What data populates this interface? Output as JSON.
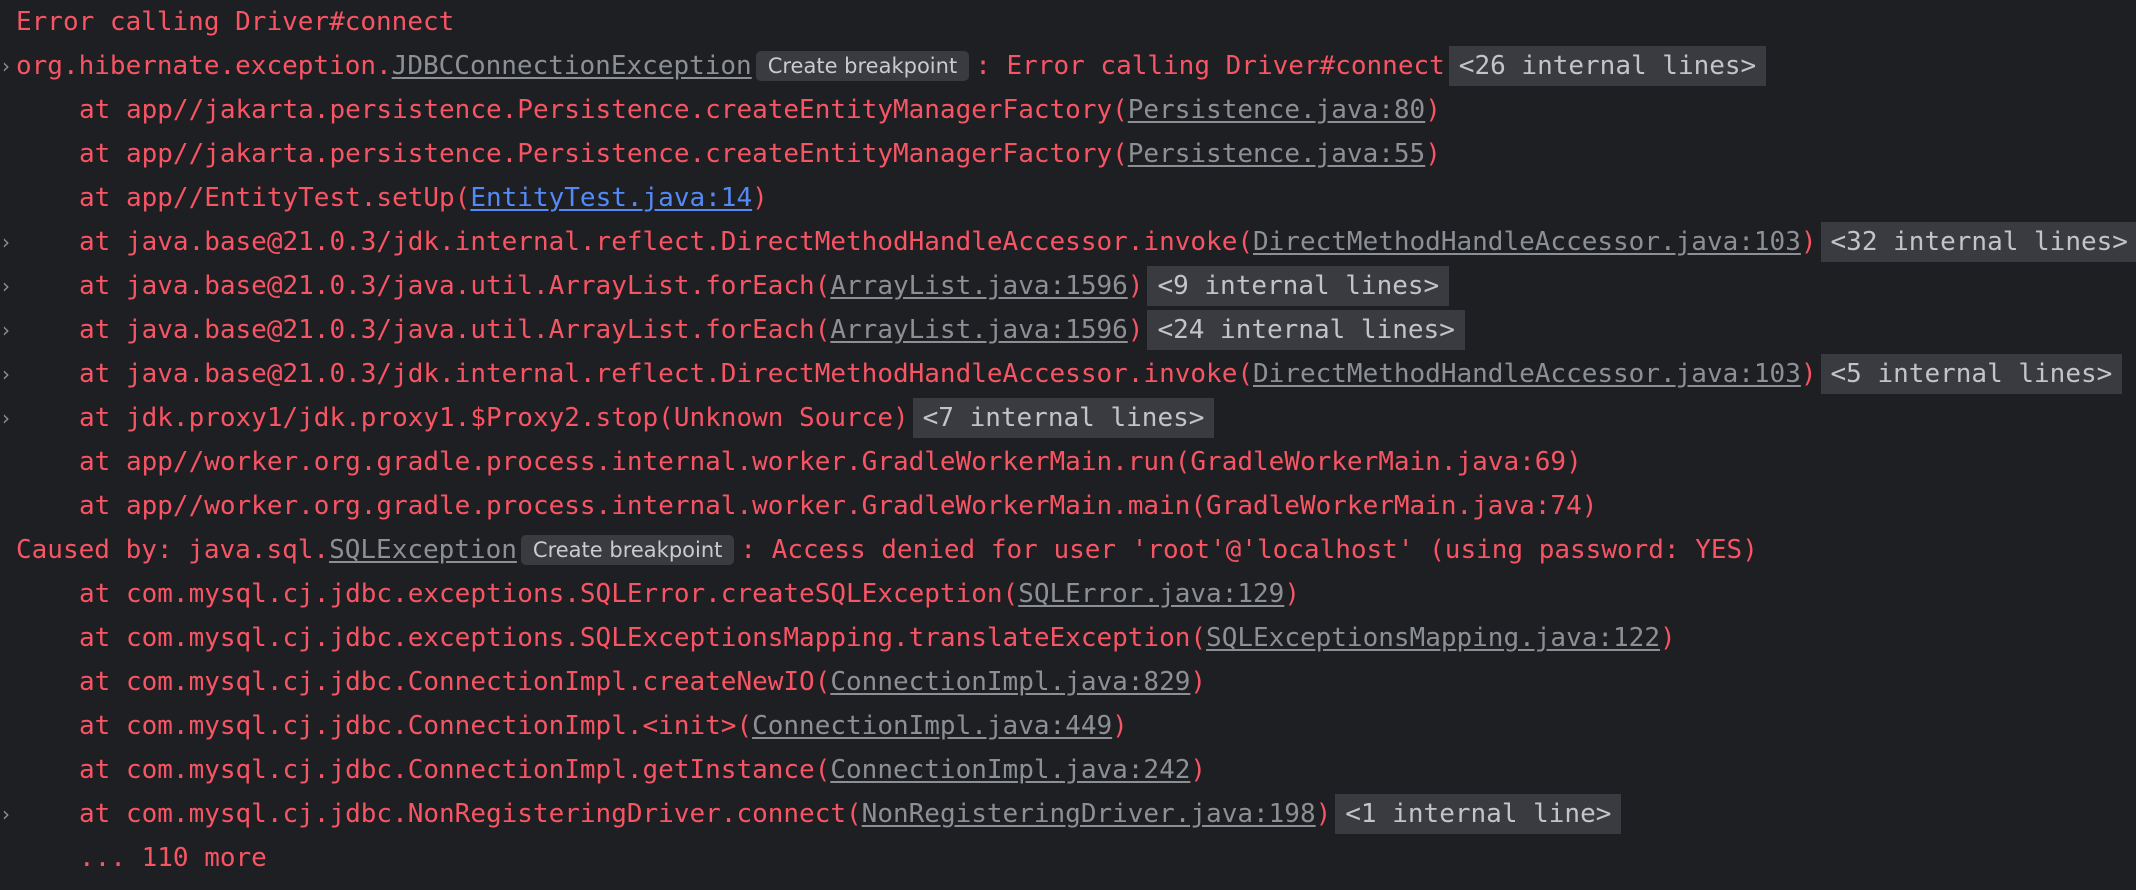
{
  "lines": {
    "l0": {
      "text": "Error calling Driver#connect"
    },
    "l1": {
      "pre": "org.hibernate.exception.",
      "cls": "JDBCConnectionException",
      "bp": "Create breakpoint",
      "post": ": Error calling Driver#connect",
      "internal": "<26 internal lines>"
    },
    "l2": {
      "pre": "at app//jakarta.persistence.Persistence.createEntityManagerFactory(",
      "link": "Persistence.java:80",
      "post": ")"
    },
    "l3": {
      "pre": "at app//jakarta.persistence.Persistence.createEntityManagerFactory(",
      "link": "Persistence.java:55",
      "post": ")"
    },
    "l4": {
      "pre": "at app//EntityTest.setUp(",
      "link": "EntityTest.java:14",
      "post": ")"
    },
    "l5": {
      "pre": "at java.base@21.0.3/jdk.internal.reflect.DirectMethodHandleAccessor.invoke(",
      "link": "DirectMethodHandleAccessor.java:103",
      "post": ")",
      "internal": "<32 internal lines>"
    },
    "l6": {
      "pre": "at java.base@21.0.3/java.util.ArrayList.forEach(",
      "link": "ArrayList.java:1596",
      "post": ")",
      "internal": "<9 internal lines>"
    },
    "l7": {
      "pre": "at java.base@21.0.3/java.util.ArrayList.forEach(",
      "link": "ArrayList.java:1596",
      "post": ")",
      "internal": "<24 internal lines>"
    },
    "l8": {
      "pre": "at java.base@21.0.3/jdk.internal.reflect.DirectMethodHandleAccessor.invoke(",
      "link": "DirectMethodHandleAccessor.java:103",
      "post": ")",
      "internal": "<5 internal lines>"
    },
    "l9": {
      "text": "at jdk.proxy1/jdk.proxy1.$Proxy2.stop(Unknown Source)",
      "internal": "<7 internal lines>"
    },
    "l10": {
      "text": "at app//worker.org.gradle.process.internal.worker.GradleWorkerMain.run(GradleWorkerMain.java:69)"
    },
    "l11": {
      "text": "at app//worker.org.gradle.process.internal.worker.GradleWorkerMain.main(GradleWorkerMain.java:74)"
    },
    "l12": {
      "pre": "Caused by: java.sql.",
      "cls": "SQLException",
      "bp": "Create breakpoint",
      "post": ": Access denied for user 'root'@'localhost' (using password: YES)"
    },
    "l13": {
      "pre": "at com.mysql.cj.jdbc.exceptions.SQLError.createSQLException(",
      "link": "SQLError.java:129",
      "post": ")"
    },
    "l14": {
      "pre": "at com.mysql.cj.jdbc.exceptions.SQLExceptionsMapping.translateException(",
      "link": "SQLExceptionsMapping.java:122",
      "post": ")"
    },
    "l15": {
      "pre": "at com.mysql.cj.jdbc.ConnectionImpl.createNewIO(",
      "link": "ConnectionImpl.java:829",
      "post": ")"
    },
    "l16": {
      "pre": "at com.mysql.cj.jdbc.ConnectionImpl.<init>(",
      "link": "ConnectionImpl.java:449",
      "post": ")"
    },
    "l17": {
      "pre": "at com.mysql.cj.jdbc.ConnectionImpl.getInstance(",
      "link": "ConnectionImpl.java:242",
      "post": ")"
    },
    "l18": {
      "pre": "at com.mysql.cj.jdbc.NonRegisteringDriver.connect(",
      "link": "NonRegisteringDriver.java:198",
      "post": ")",
      "internal": "<1 internal line>"
    },
    "l19": {
      "text": "... 110 more"
    }
  },
  "icons": {
    "expand": "chevron-right-icon",
    "chevron_glyph": "›"
  },
  "colors": {
    "background": "#1e1f22",
    "error_text": "#f75464",
    "muted_link": "#8c8f94",
    "source_link": "#548af7",
    "badge_bg": "#393b40"
  }
}
